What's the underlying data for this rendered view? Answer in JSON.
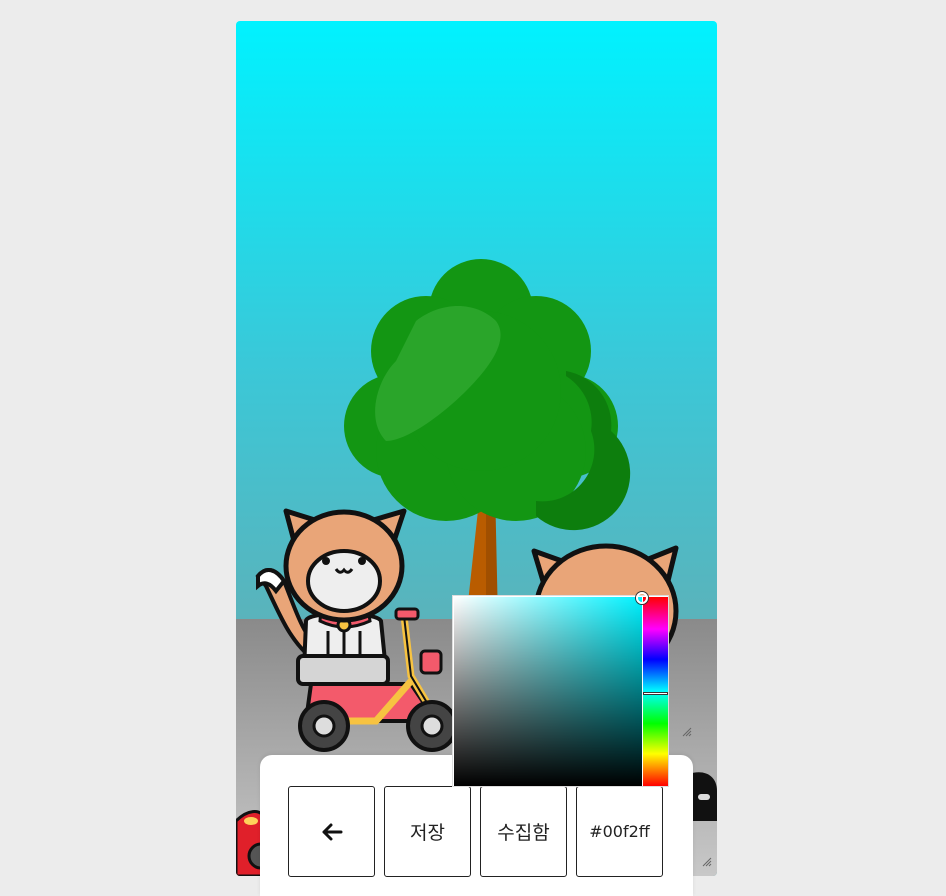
{
  "toolbar": {
    "back_icon": "arrow-left-icon",
    "back_glyph": "←",
    "save_label": "저장",
    "collection_label": "수집함",
    "color_hex": "#00f2ff"
  },
  "color_picker": {
    "current_color": "#00f2ff",
    "hue_level": 0.51
  },
  "scene": {
    "sky_top_color": "#00f2ff",
    "tree_color": "#139613",
    "cat_color": "#e9a578",
    "scooter_color": "#f35a6b"
  }
}
